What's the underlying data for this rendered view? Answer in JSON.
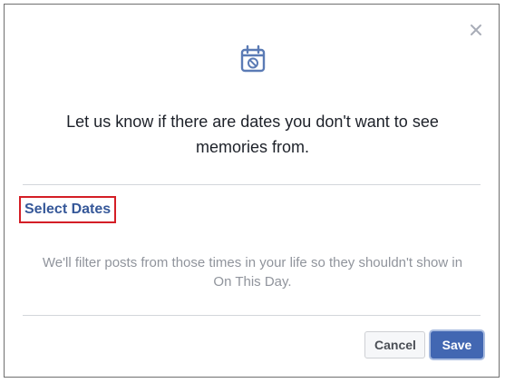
{
  "dialog": {
    "close_icon": "close-icon",
    "header_icon": "calendar-block-icon",
    "heading": "Let us know if there are dates you don't want to see memories from.",
    "select_dates_link": "Select Dates",
    "info_text": "We'll filter posts from those times in your life so they shouldn't show in On This Day.",
    "cancel_label": "Cancel",
    "save_label": "Save"
  },
  "colors": {
    "brand_blue": "#4267b2",
    "link_blue": "#365899",
    "highlight_red": "#d41e26",
    "icon_blue": "#5b7bb5",
    "muted_text": "#90949c"
  }
}
